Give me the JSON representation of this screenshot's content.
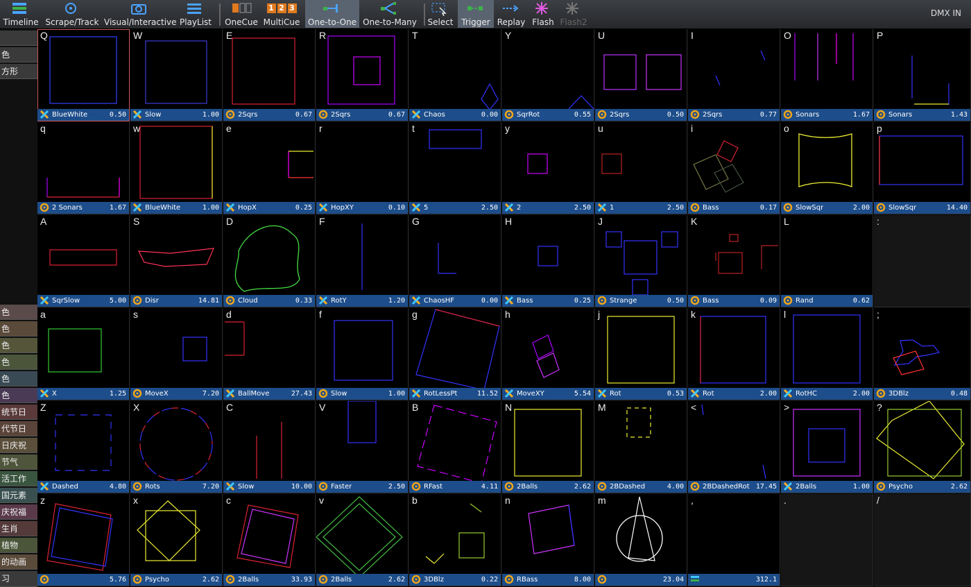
{
  "toolbar": {
    "items": [
      {
        "label": "Timeline",
        "icon": "timeline-icon"
      },
      {
        "label": "Scrape/Track",
        "icon": "scrape-icon"
      },
      {
        "label": "Visual/Interactive",
        "icon": "camera-icon"
      },
      {
        "label": "PlayList",
        "icon": "playlist-icon"
      },
      {
        "label": "OneCue",
        "icon": "onecue-icon"
      },
      {
        "label": "MultiCue",
        "icon": "multicue-icon",
        "digits": [
          "1",
          "2",
          "3"
        ]
      },
      {
        "label": "One-to-One",
        "icon": "one-to-one-icon",
        "active": true
      },
      {
        "label": "One-to-Many",
        "icon": "one-to-many-icon"
      },
      {
        "label": "Select",
        "icon": "select-icon"
      },
      {
        "label": "Trigger",
        "icon": "trigger-icon",
        "active": true
      },
      {
        "label": "Replay",
        "icon": "replay-icon"
      },
      {
        "label": "Flash",
        "icon": "flash-icon"
      },
      {
        "label": "Flash2",
        "icon": "flash2-icon",
        "disabled": true
      }
    ],
    "dmx": "DMX IN"
  },
  "sidebar": [
    {
      "label": "",
      "color": "#3a3a3a"
    },
    {
      "label": "色",
      "color": "#3a3a3a"
    },
    {
      "label": "方形",
      "color": "#3a3a3a"
    },
    {
      "label": "色",
      "color": "#5a4a4a"
    },
    {
      "label": "色",
      "color": "#5a4a3a"
    },
    {
      "label": "色",
      "color": "#55553a"
    },
    {
      "label": "色",
      "color": "#4a553a"
    },
    {
      "label": "色",
      "color": "#3a4a55"
    },
    {
      "label": "色",
      "color": "#4a3a55"
    },
    {
      "label": "统节日",
      "color": "#5a3a3a"
    },
    {
      "label": "代节日",
      "color": "#5a443a"
    },
    {
      "label": "日庆祝",
      "color": "#5a4f3a"
    },
    {
      "label": "节气",
      "color": "#4f553a"
    },
    {
      "label": "活工作",
      "color": "#3a553f"
    },
    {
      "label": "国元素",
      "color": "#3a5050"
    },
    {
      "label": "庆祝福",
      "color": "#5a3a4a"
    },
    {
      "label": "生肖",
      "color": "#553a3a"
    },
    {
      "label": "植物",
      "color": "#4a553a"
    },
    {
      "label": "的动画",
      "color": "#5a4a3a"
    },
    {
      "label": "习",
      "color": "#3a3a3a"
    }
  ],
  "grid": {
    "rows": [
      [
        {
          "k": "Q",
          "n": "BlueWhite",
          "v": "0.50",
          "i": "x"
        },
        {
          "k": "W",
          "n": "Slow",
          "v": "1.00",
          "i": "x"
        },
        {
          "k": "E",
          "n": "2Sqrs",
          "v": "0.67",
          "i": "o"
        },
        {
          "k": "R",
          "n": "2Sqrs",
          "v": "0.67",
          "i": "o"
        },
        {
          "k": "T",
          "n": "Chaos",
          "v": "0.00",
          "i": "x"
        },
        {
          "k": "Y",
          "n": "SqrRot",
          "v": "0.55",
          "i": "o"
        },
        {
          "k": "U",
          "n": "2Sqrs",
          "v": "0.50",
          "i": "o"
        },
        {
          "k": "I",
          "n": "2Sqrs",
          "v": "0.77",
          "i": "o"
        },
        {
          "k": "O",
          "n": "Sonars",
          "v": "1.67",
          "i": "o"
        },
        {
          "k": "P",
          "n": "Sonars",
          "v": "1.43",
          "i": "o"
        }
      ],
      [
        {
          "k": "q",
          "n": "2 Sonars",
          "v": "1.67",
          "i": "o"
        },
        {
          "k": "w",
          "n": "BlueWhite",
          "v": "1.00",
          "i": "x"
        },
        {
          "k": "e",
          "n": "HopX",
          "v": "0.25",
          "i": "x"
        },
        {
          "k": "r",
          "n": "HopXY",
          "v": "0.10",
          "i": "x"
        },
        {
          "k": "t",
          "n": "5",
          "v": "2.50",
          "i": "x"
        },
        {
          "k": "y",
          "n": "2",
          "v": "2.50",
          "i": "x"
        },
        {
          "k": "u",
          "n": "1",
          "v": "2.50",
          "i": "x"
        },
        {
          "k": "i",
          "n": "Bass",
          "v": "0.17",
          "i": "o"
        },
        {
          "k": "o",
          "n": "SlowSqr",
          "v": "2.00",
          "i": "o"
        },
        {
          "k": "p",
          "n": "SlowSqr",
          "v": "14.40",
          "i": "o"
        }
      ],
      [
        {
          "k": "A",
          "n": "SqrSlow",
          "v": "5.00",
          "i": "x"
        },
        {
          "k": "S",
          "n": "Disr",
          "v": "14.81",
          "i": "o"
        },
        {
          "k": "D",
          "n": "Cloud",
          "v": "0.33",
          "i": "o"
        },
        {
          "k": "F",
          "n": "RotY",
          "v": "1.20",
          "i": "x"
        },
        {
          "k": "G",
          "n": "ChaosHF",
          "v": "0.00",
          "i": "x"
        },
        {
          "k": "H",
          "n": "Bass",
          "v": "0.25",
          "i": "x"
        },
        {
          "k": "J",
          "n": "Strange",
          "v": "0.50",
          "i": "o"
        },
        {
          "k": "K",
          "n": "Bass",
          "v": "0.09",
          "i": "o"
        },
        {
          "k": "L",
          "n": "Rand",
          "v": "0.62",
          "i": "o"
        },
        {
          "k": ":",
          "empty": true
        }
      ],
      [
        {
          "k": "a",
          "n": "X",
          "v": "1.25",
          "i": "x"
        },
        {
          "k": "s",
          "n": "MoveX",
          "v": "7.20",
          "i": "o"
        },
        {
          "k": "d",
          "n": "BallMove",
          "v": "27.43",
          "i": "x"
        },
        {
          "k": "f",
          "n": "Slow",
          "v": "1.00",
          "i": "o"
        },
        {
          "k": "g",
          "n": "RotLessPt",
          "v": "11.52",
          "i": "x"
        },
        {
          "k": "h",
          "n": "MoveXY",
          "v": "5.54",
          "i": "x"
        },
        {
          "k": "j",
          "n": "Rot",
          "v": "0.53",
          "i": "x"
        },
        {
          "k": "k",
          "n": "Rot",
          "v": "2.00",
          "i": "x"
        },
        {
          "k": "l",
          "n": "RotHC",
          "v": "2.00",
          "i": "x"
        },
        {
          "k": ";",
          "n": "3DBlz",
          "v": "0.48",
          "i": "o"
        }
      ],
      [
        {
          "k": "Z",
          "n": "Dashed",
          "v": "4.80",
          "i": "x"
        },
        {
          "k": "X",
          "n": "Rots",
          "v": "7.20",
          "i": "o"
        },
        {
          "k": "C",
          "n": "Slow",
          "v": "10.00",
          "i": "x"
        },
        {
          "k": "V",
          "n": "Faster",
          "v": "2.50",
          "i": "o"
        },
        {
          "k": "B",
          "n": "RFast",
          "v": "4.11",
          "i": "o"
        },
        {
          "k": "N",
          "n": "2Balls",
          "v": "2.62",
          "i": "o"
        },
        {
          "k": "M",
          "n": "2BDashed",
          "v": "4.00",
          "i": "o"
        },
        {
          "k": "<",
          "n": "2BDashedRot",
          "v": "17.45",
          "i": "o"
        },
        {
          "k": ">",
          "n": "2Balls",
          "v": "1.00",
          "i": "x"
        },
        {
          "k": "?",
          "n": "Psycho",
          "v": "2.62",
          "i": "o"
        }
      ],
      [
        {
          "k": "z",
          "n": "",
          "v": "5.76",
          "i": "o"
        },
        {
          "k": "x",
          "n": "Psycho",
          "v": "2.62",
          "i": "o"
        },
        {
          "k": "c",
          "n": "2Balls",
          "v": "33.93",
          "i": "o"
        },
        {
          "k": "v",
          "n": "2Balls",
          "v": "2.62",
          "i": "o"
        },
        {
          "k": "b",
          "n": "3DBlz",
          "v": "0.22",
          "i": "o"
        },
        {
          "k": "n",
          "n": "RBass",
          "v": "8.00",
          "i": "o"
        },
        {
          "k": "m",
          "n": "",
          "v": "23.04",
          "i": "o"
        },
        {
          "k": ",",
          "n": "",
          "v": "312.1",
          "i": "t"
        },
        {
          "k": ".",
          "empty": true
        },
        {
          "k": "/",
          "empty": true
        }
      ]
    ]
  }
}
